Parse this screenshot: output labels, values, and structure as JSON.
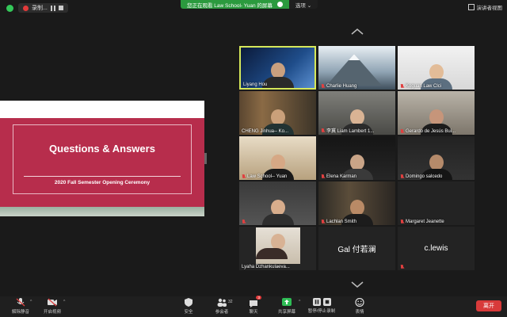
{
  "top": {
    "recording_label": "录制...",
    "share_banner": "您正在观看 Law School- Yuan 的屏幕",
    "share_options": "选项",
    "view_button": "演讲者视图"
  },
  "slide": {
    "title": "Questions & Answers",
    "subtitle": "2020 Fall Semester Opening Ceremony"
  },
  "participants": [
    {
      "name": "Liyang Hou",
      "muted": false,
      "active": true
    },
    {
      "name": "Charlie Huang",
      "muted": true
    },
    {
      "name": "Koguan Law Clci",
      "muted": true
    },
    {
      "name": "CHENG Jinhua-- Ko...",
      "muted": false
    },
    {
      "name": "李冀 Liam Lambert 1...",
      "muted": true
    },
    {
      "name": "Gerardo de Jesús Bui...",
      "muted": true
    },
    {
      "name": "Law School-- Yuan",
      "muted": true
    },
    {
      "name": "Elena Karman",
      "muted": true
    },
    {
      "name": "Domingo salcedo",
      "muted": true
    },
    {
      "name": "",
      "muted": true
    },
    {
      "name": "Lachlan Smith",
      "muted": true
    },
    {
      "name": "Margaret Jeanette",
      "muted": true
    },
    {
      "name": "Lyaha Dzhankulaeva...",
      "muted": true
    },
    {
      "name": "Gal 付若澜",
      "muted": false
    },
    {
      "name": "c.lewis",
      "muted": true
    }
  ],
  "toolbar": {
    "unmute": "解除静音",
    "start_video": "开启视频",
    "security": "安全",
    "participants": "参会者",
    "participants_count": "32",
    "chat": "聊天",
    "chat_badge": "3",
    "share_screen": "共享屏幕",
    "record": "暂停/停止录制",
    "reactions": "表情",
    "end": "离开"
  },
  "colors": {
    "slide_red": "#b72d4c",
    "share_green": "#2b9a3e",
    "end_red": "#d83a3a",
    "active_border": "#d6e85a"
  }
}
